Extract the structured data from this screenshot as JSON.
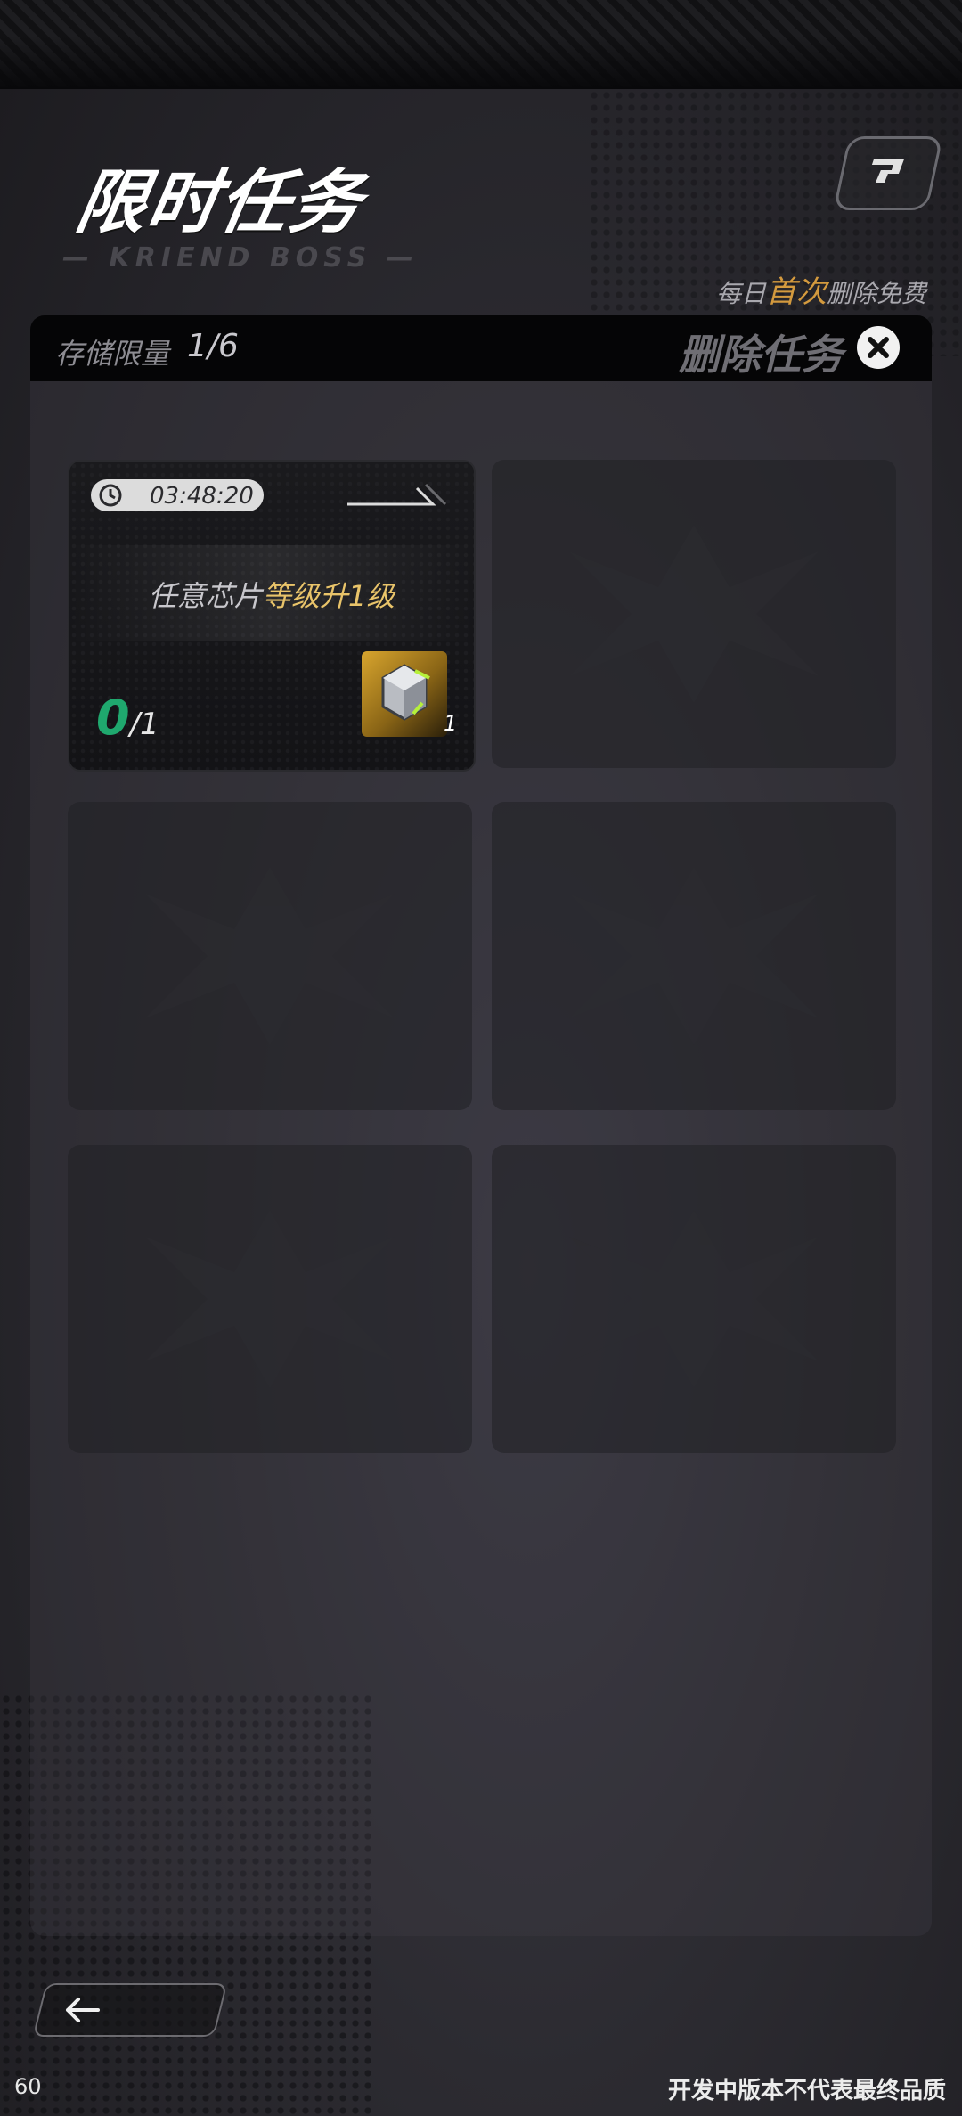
{
  "title": "限时任务",
  "subtitle_deco": "— KRIEND BOSS —",
  "daily_note": {
    "prefix": "每日",
    "highlight": "首次",
    "suffix": "删除免费"
  },
  "storage": {
    "label": "存储限量",
    "value": "1/6"
  },
  "delete_label": "删除任务",
  "task": {
    "timer": "03:48:20",
    "desc_prefix": "任意芯片",
    "desc_highlight": "等级升1级",
    "progress_current": "0",
    "progress_total": "/1",
    "reward_count": "1"
  },
  "empty_slots": 5,
  "fps": "60",
  "watermark": "开发中版本不代表最终品质",
  "colors": {
    "accent_orange": "#d49a3e",
    "highlight_yellow": "#e9c46a",
    "progress_green": "#1fa86e"
  },
  "icons": [
    "help-icon",
    "close-icon",
    "timer-icon",
    "chip-reward-icon",
    "back-arrow-icon",
    "empty-slot-emblem"
  ]
}
